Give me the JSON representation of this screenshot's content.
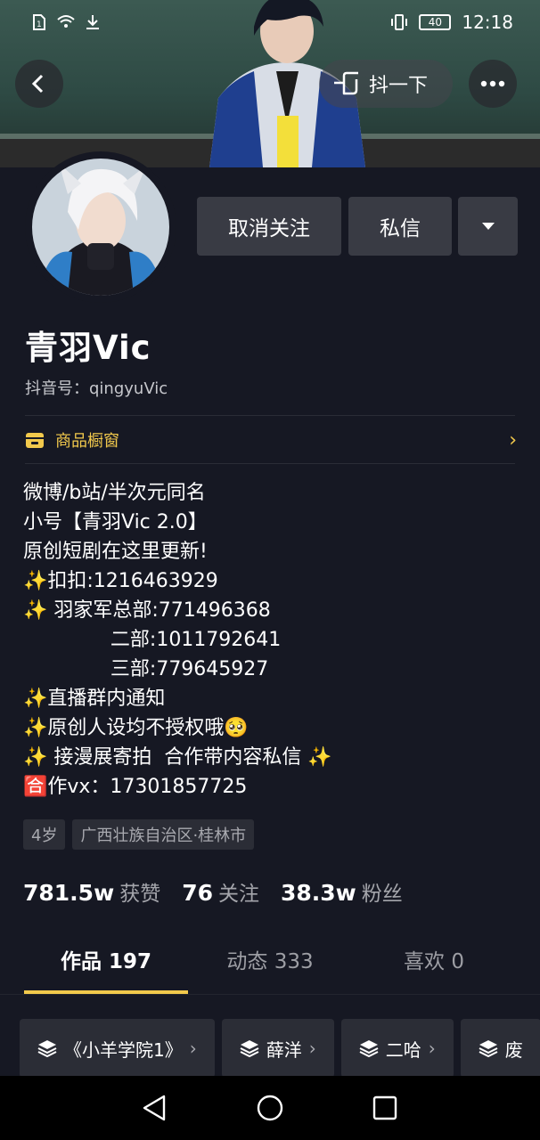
{
  "status_bar": {
    "battery": "40",
    "time": "12:18"
  },
  "header": {
    "shake_label": "抖一下"
  },
  "profile": {
    "follow_button": "取消关注",
    "message_button": "私信",
    "name": "青羽Vic",
    "douyin_id": "抖音号：qingyuVic",
    "shop_label": "商品橱窗"
  },
  "bio": [
    "微博/b站/半次元同名",
    "小号【青羽Vic 2.0】",
    "原创短剧在这里更新!",
    "✨扣扣:1216463929",
    "✨ 羽家军总部:771496368",
    "              二部:1011792641",
    "              三部:779645927",
    "✨直播群内通知",
    "✨原创人设均不授权哦🥺",
    "✨ 接漫展寄拍  合作带内容私信 ✨",
    "🈴作vx：17301857725"
  ],
  "tags": [
    "4岁",
    "广西壮族自治区·桂林市"
  ],
  "stats": {
    "likes_num": "781.5w",
    "likes_label": "获赞",
    "following_num": "76",
    "following_label": "关注",
    "fans_num": "38.3w",
    "fans_label": "粉丝"
  },
  "tabs": [
    {
      "label": "作品 197"
    },
    {
      "label": "动态 333"
    },
    {
      "label": "喜欢 0"
    }
  ],
  "collections": [
    {
      "label": "《小羊学院1》"
    },
    {
      "label": "薛洋"
    },
    {
      "label": "二哈"
    },
    {
      "label": "废"
    }
  ],
  "colors": {
    "accent": "#f2c94c",
    "background": "#161823",
    "button": "#393b44"
  }
}
